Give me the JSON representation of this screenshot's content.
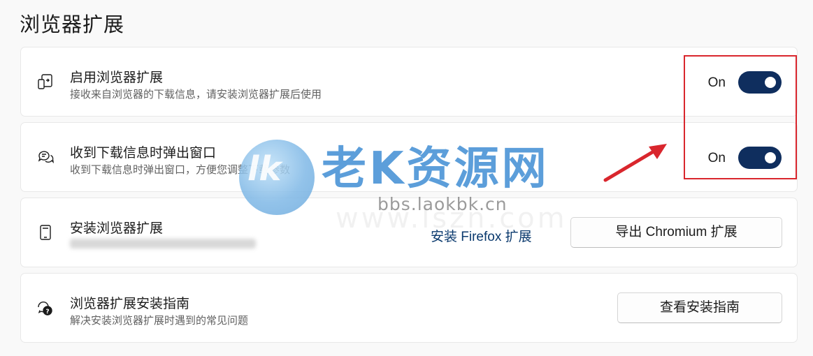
{
  "page": {
    "title": "浏览器扩展"
  },
  "cards": [
    {
      "icon": "device-link-icon",
      "title": "启用浏览器扩展",
      "description": "接收来自浏览器的下载信息，请安装浏览器扩展后使用",
      "toggle_state": "On",
      "toggle_on": true
    },
    {
      "icon": "chat-bubbles-icon",
      "title": "收到下载信息时弹出窗口",
      "description": "收到下载信息时弹出窗口，方便您调整下载参数",
      "toggle_state": "On",
      "toggle_on": true
    },
    {
      "icon": "tablet-icon",
      "title": "安装浏览器扩展",
      "link_label": "安装 Firefox 扩展",
      "button_label": "导出 Chromium 扩展"
    },
    {
      "icon": "help-chat-icon",
      "title": "浏览器扩展安装指南",
      "description": "解决安装浏览器扩展时遇到的常见问题",
      "button_label": "查看安装指南"
    }
  ],
  "watermark": {
    "logo_text": "lk",
    "brand": "老K资源网",
    "url": "bbs.laokbk.cn",
    "url2": "www.lszn.com"
  },
  "colors": {
    "toggle_on": "#0f2e5e",
    "link": "#0b3a6e",
    "highlight": "#d9262d",
    "watermark_blue": "#4b94d6"
  }
}
